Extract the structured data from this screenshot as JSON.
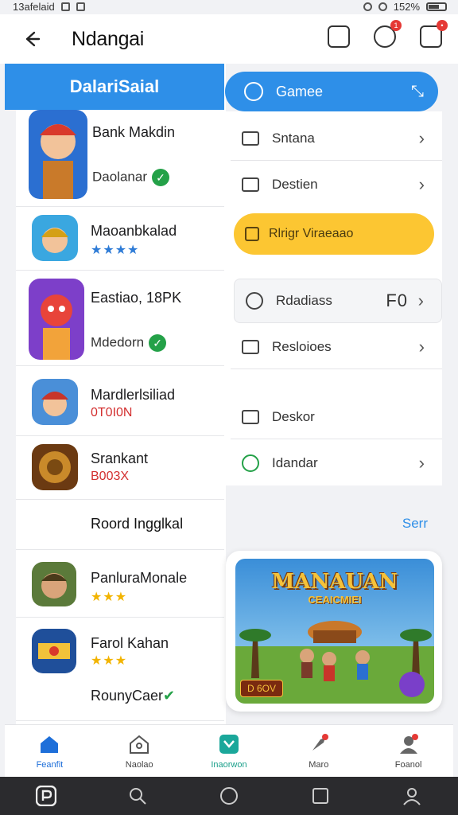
{
  "status_bar": {
    "left_text": "13afelaid",
    "right_text": "152%"
  },
  "header": {
    "back_icon": "arrow-left-icon",
    "title": "Ndangai"
  },
  "left_header": {
    "label": "DalariSaial"
  },
  "games": [
    {
      "name": "Bank Makdin",
      "sub": "Daolanar",
      "badge": "check"
    },
    {
      "name": "Maoanbkalad",
      "rating": "★★★★"
    },
    {
      "name": "Eastiao, 18PK",
      "sub": "Mdedorn",
      "badge": "check"
    },
    {
      "name": "Mardlerlsiliad",
      "sub": "0T0I0N"
    },
    {
      "name": "Srankant",
      "sub": "B003X"
    },
    {
      "name": "PanluraMonale",
      "rating": "★★★"
    },
    {
      "name": "Farol Kahan",
      "rating": "★★★"
    }
  ],
  "round_label": "Roord Ingglkal",
  "round_card_label": "RounyCaer",
  "see_link": "Serr",
  "games_pill": {
    "label": "Gamee"
  },
  "menu": {
    "item1": "Sntana",
    "item2": "Destien",
    "yellow": "Rlrigr Viraeaao",
    "item3": "Rdadiass",
    "item3_value": "F0",
    "item4": "Resloioes",
    "item5": "Deskor",
    "item6": "Idandar"
  },
  "banner": {
    "title": "MANAUAN",
    "subtitle": "CEAICMIEI",
    "badge": "D 6OV"
  },
  "bottom_nav": [
    {
      "label": "Feanfit",
      "icon": "home-icon"
    },
    {
      "label": "Naolao",
      "icon": "house-outline-icon"
    },
    {
      "label": "Inaorwon",
      "icon": "store-icon"
    },
    {
      "label": "Maro",
      "icon": "rocket-icon"
    },
    {
      "label": "Foanol",
      "icon": "profile-icon"
    }
  ],
  "colors": {
    "primary": "#2e8fe8",
    "accent_yellow": "#fcc632",
    "check_green": "#24a148",
    "sys_nav": "#2b2b2e"
  }
}
